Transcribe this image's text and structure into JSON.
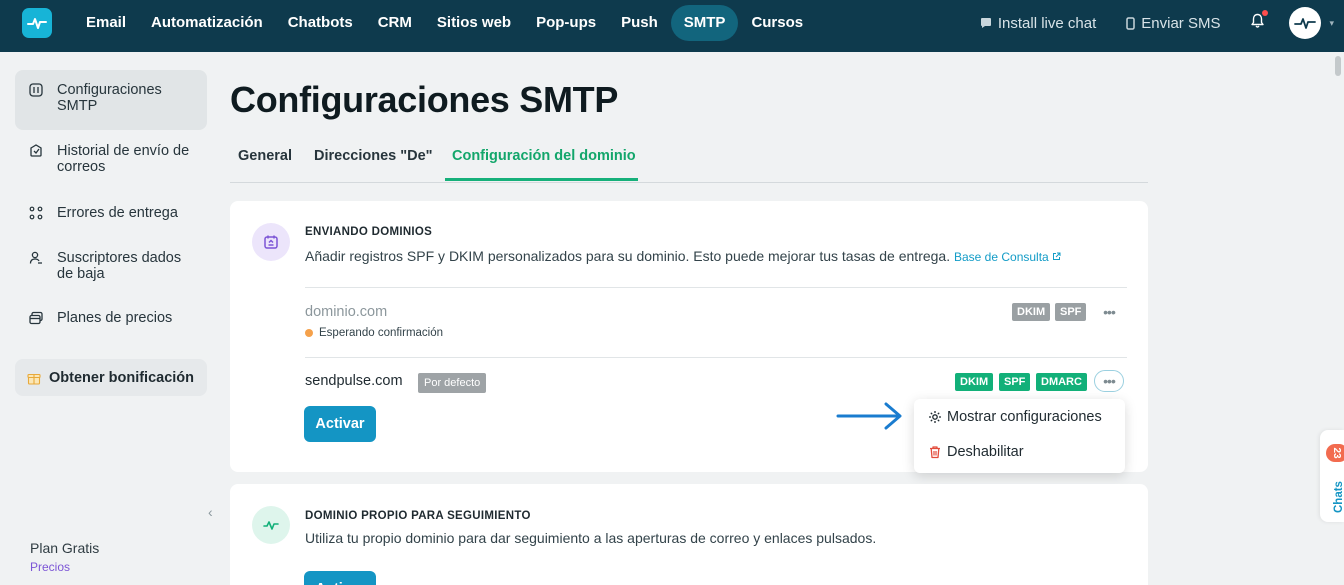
{
  "topnav": {
    "items": [
      {
        "label": "Email"
      },
      {
        "label": "Automatización"
      },
      {
        "label": "Chatbots"
      },
      {
        "label": "CRM"
      },
      {
        "label": "Sitios web"
      },
      {
        "label": "Pop-ups"
      },
      {
        "label": "Push"
      },
      {
        "label": "SMTP",
        "active": true
      },
      {
        "label": "Cursos"
      }
    ],
    "install_live_chat": "Install live chat",
    "send_sms": "Enviar SMS"
  },
  "sidebar": {
    "items": [
      {
        "label": "Configuraciones SMTP",
        "icon": "smtp-settings-icon",
        "active": true
      },
      {
        "label": "Historial de envío de correos",
        "icon": "history-icon"
      },
      {
        "label": "Errores de entrega",
        "icon": "errors-icon"
      },
      {
        "label": "Suscriptores dados de baja",
        "icon": "unsubscribed-icon"
      },
      {
        "label": "Planes de precios",
        "icon": "pricing-icon"
      }
    ],
    "bonus": "Obtener bonificación",
    "plan": "Plan Gratis",
    "pricing_link": "Precios"
  },
  "page": {
    "title": "Configuraciones SMTP",
    "tabs": [
      {
        "label": "General"
      },
      {
        "label": "Direcciones \"De\""
      },
      {
        "label": "Configuración del dominio",
        "active": true
      }
    ]
  },
  "sending_domains": {
    "heading": "ENVIANDO DOMINIOS",
    "description": "Añadir registros SPF y DKIM personalizados para su dominio. Esto puede mejorar tus tasas de entrega.",
    "kb_link": "Base de Consulta",
    "domains": [
      {
        "name": "dominio.com",
        "status": "Esperando confirmación",
        "records": [
          "DKIM",
          "SPF"
        ]
      },
      {
        "name": "sendpulse.com",
        "default_badge": "Por defecto",
        "records": [
          "DKIM",
          "SPF",
          "DMARC"
        ]
      }
    ],
    "activate": "Activar",
    "menu": {
      "show_settings": "Mostrar configuraciones",
      "disable": "Deshabilitar"
    }
  },
  "tracking_domain": {
    "heading": "DOMINIO PROPIO PARA SEGUIMIENTO",
    "description": "Utiliza tu propio dominio para dar seguimiento a las aperturas de correo y enlaces pulsados.",
    "activate": "Activar"
  },
  "chats_widget": {
    "label": "Chats",
    "count": "23"
  },
  "colors": {
    "nav_bg": "#0e3a4d",
    "accent_green": "#12b079",
    "primary_blue": "#1495c4"
  }
}
